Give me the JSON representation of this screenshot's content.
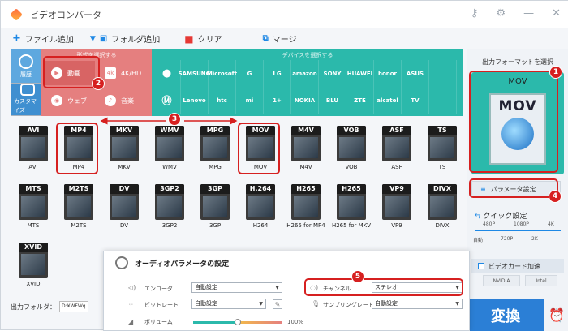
{
  "window": {
    "title": "ビデオコンバータ"
  },
  "toolbar": {
    "add_file": "ファイル追加",
    "add_folder": "フォルダ追加",
    "clear": "クリア",
    "merge": "マージ"
  },
  "leftnav": {
    "history": "履歴",
    "custom": "カスタマイズ"
  },
  "format_panel": {
    "header": "形式を選択する",
    "video": "動画",
    "hd": "4K/HD",
    "web": "ウェブ",
    "music": "音楽"
  },
  "device_panel": {
    "header": "デバイスを選択する",
    "row1": [
      "",
      "SAMSUNG",
      "Microsoft",
      "G",
      "LG",
      "amazon",
      "SONY",
      "HUAWEI",
      "honor",
      "ASUS",
      ""
    ],
    "row2": [
      "",
      "Lenovo",
      "htc",
      "mi",
      "1+",
      "NOKIA",
      "BLU",
      "ZTE",
      "alcatel",
      "TV",
      ""
    ]
  },
  "formats_row1": [
    {
      "tag": "AVI",
      "name": "AVI"
    },
    {
      "tag": "MP4",
      "name": "MP4"
    },
    {
      "tag": "MKV",
      "name": "MKV"
    },
    {
      "tag": "WMV",
      "name": "WMV"
    },
    {
      "tag": "MPG",
      "name": "MPG"
    },
    {
      "tag": "MOV",
      "name": "MOV"
    },
    {
      "tag": "M4V",
      "name": "M4V"
    },
    {
      "tag": "VOB",
      "name": "VOB"
    },
    {
      "tag": "ASF",
      "name": "ASF"
    },
    {
      "tag": "TS",
      "name": "TS"
    }
  ],
  "formats_row2": [
    {
      "tag": "MTS",
      "name": "MTS"
    },
    {
      "tag": "M2TS",
      "name": "M2TS"
    },
    {
      "tag": "DV",
      "name": "DV"
    },
    {
      "tag": "3GP2",
      "name": "3GP2"
    },
    {
      "tag": "3GP",
      "name": "3GP"
    },
    {
      "tag": "H.264",
      "name": "H264"
    },
    {
      "tag": "H265",
      "name": "H265 for MP4"
    },
    {
      "tag": "H265",
      "name": "H265 for MKV"
    },
    {
      "tag": "VP9",
      "name": "VP9"
    },
    {
      "tag": "DIVX",
      "name": "DIVX"
    }
  ],
  "formats_row3": [
    {
      "tag": "XVID",
      "name": "XVID"
    }
  ],
  "right_panel": {
    "select_label": "出力フォーマットを選択",
    "selected_format": "MOV",
    "param_button": "パラメータ設定",
    "quick_settings": "クイック設定",
    "q_480": "480P",
    "q_1080": "1080P",
    "q_4k": "4K",
    "q_auto": "自動",
    "q_720": "720P",
    "q_2k": "2K",
    "gpu_accel": "ビデオカード加速",
    "nvidia": "NVIDIA",
    "intel": "Intel",
    "convert": "変換"
  },
  "bottom": {
    "output_folder": "出力フォルダ：",
    "path": "D:¥WFWq"
  },
  "audio_dialog": {
    "title": "オーディオパラメータの設定",
    "encoder_label": "エンコーダ",
    "encoder_value": "自動設定",
    "bitrate_label": "ビットレート",
    "bitrate_value": "自動設定",
    "volume_label": "ボリューム",
    "volume_pct": "100%",
    "volume_level": 0.5,
    "channel_label": "チャンネル",
    "channel_value": "ステレオ",
    "samplerate_label": "サンプリングレート",
    "samplerate_value": "自動設定"
  },
  "annotations": [
    "1",
    "2",
    "3",
    "4",
    "5"
  ],
  "colors": {
    "accent": "#2bb9ab",
    "red_panel": "#e57f7f",
    "blue": "#2b7fd6",
    "marker": "#d62020"
  }
}
